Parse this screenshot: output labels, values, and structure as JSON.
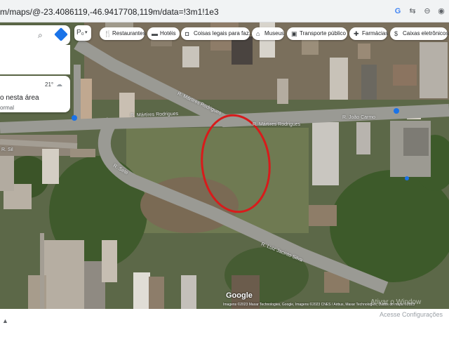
{
  "browser": {
    "url": "m/maps/@-23.4086119,-46.9417708,119m/data=!3m1!1e3",
    "icons": [
      "google-g-icon",
      "translate-icon",
      "zoom-icon",
      "eye-off-icon"
    ]
  },
  "search": {
    "icon": "search-icon",
    "directions_icon": "directions-icon"
  },
  "layers_button": {
    "label": "P₀",
    "chevron": "▾"
  },
  "layer_card": {
    "temperature": "21°",
    "line1": "o nesta área",
    "line2": "ormal"
  },
  "chips": [
    {
      "label": "Restaurantes",
      "icon": "fork-knife-icon"
    },
    {
      "label": "Hotéis",
      "icon": "bed-icon"
    },
    {
      "label": "Coisas legais para faz...",
      "icon": "camera-icon"
    },
    {
      "label": "Museus",
      "icon": "museum-icon"
    },
    {
      "label": "Transporte público",
      "icon": "bus-icon"
    },
    {
      "label": "Farmácias",
      "icon": "pharmacy-icon"
    },
    {
      "label": "Caixas eletrônicos",
      "icon": "atm-icon"
    }
  ],
  "streets": [
    "R. Mártires Rodrigues",
    "R. Mártires Rodrigues",
    "R. Mártires Rodrigues",
    "R. João Carmo",
    "R. Luiz Jacinto Silva",
    "R. Sete",
    "R. Sil"
  ],
  "highlight": {
    "shape": "ellipse",
    "color": "#d81b1b"
  },
  "google_logo": "Google",
  "attribution": "Imagens ©2023 Maxar Technologies, Google, Imagens ©2023 CNES / Airbus, Maxar Technologies, Dados do mapa ©2023",
  "watermark": {
    "line1": "Ativar o Window",
    "line2": "Acesse Configurações"
  },
  "colors": {
    "highlight": "#d81b1b",
    "road": "#9a9a94",
    "accent": "#1a73e8"
  }
}
